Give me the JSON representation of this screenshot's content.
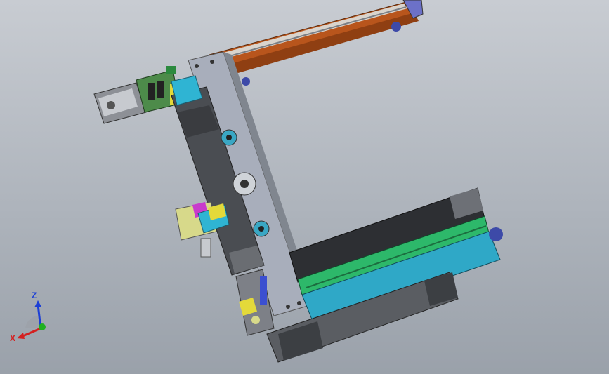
{
  "triad": {
    "z_label": "Z",
    "x_label": "X",
    "colors": {
      "z": "#1c3fd6",
      "x": "#d42020",
      "y": "#20b020"
    }
  },
  "model": {
    "colors": {
      "rail_orange": "#b8551c",
      "frame_gray": "#a8aebb",
      "slide_dark": "#4a4d52",
      "guide_green": "#2db86a",
      "base_cyan": "#2fa8c7",
      "motor_gray": "#8d9096",
      "accent_yellow": "#e3d93a",
      "accent_blue": "#3b4fd0"
    }
  }
}
